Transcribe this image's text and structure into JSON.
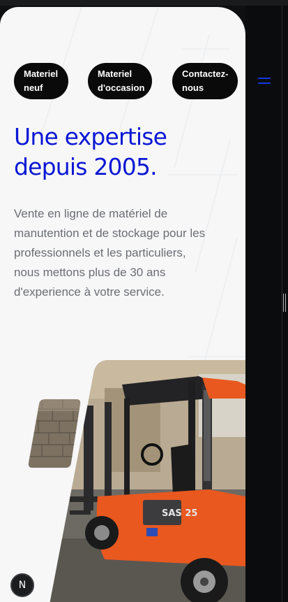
{
  "nav": {
    "items": [
      {
        "label_line1": "Materiel",
        "label_line2": "neuf"
      },
      {
        "label_line1": "Materiel",
        "label_line2": "d'occasion"
      },
      {
        "label_line1": "Contactez-",
        "label_line2": "nous"
      }
    ]
  },
  "hero": {
    "headline_line1": "Une expertise",
    "headline_line2": "depuis 2005.",
    "lead_line1": "Vente en ligne de matériel de",
    "lead_line2": "manutention et de stockage pour les",
    "lead_line3": "professionnels et les particuliers,",
    "lead_line4": "nous mettons plus de 30 ans",
    "lead_line5": "d'experience à votre service."
  },
  "photo": {
    "forklift_model": "SAS 25"
  },
  "badge": {
    "label": "N"
  },
  "colors": {
    "accent": "#0a17d4",
    "menu_icon": "#1538e6",
    "forklift_orange": "#e8581f",
    "page_bg": "#f7f7f8"
  },
  "icons": {
    "menu": "hamburger-icon",
    "badge": "nextjs-n-icon"
  }
}
